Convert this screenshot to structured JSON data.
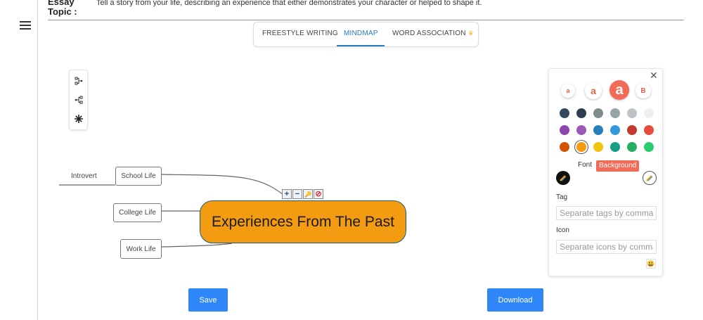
{
  "essay": {
    "label": "Essay\nTopic :",
    "text": "Tell a story from your life, describing an experience that either demonstrates your character or helped to shape it."
  },
  "tabs": [
    {
      "label": "FREESTYLE WRITING",
      "active": false
    },
    {
      "label": "MINDMAP",
      "active": true
    },
    {
      "label": "WORD ASSOCIATION",
      "active": false,
      "badge_icon": "crown-icon"
    }
  ],
  "mindmap": {
    "root": "Experiences From The Past",
    "nodes": [
      {
        "label": "Introvert"
      },
      {
        "label": "School Life"
      },
      {
        "label": "College Life"
      },
      {
        "label": "Work Life"
      }
    ],
    "node_controls": [
      "+",
      "−",
      "🔑",
      "⊘"
    ]
  },
  "style_panel": {
    "size_letters": [
      "a",
      "a",
      "a",
      "B"
    ],
    "colors": [
      "#34495e",
      "#2c3e50",
      "#7f8c8d",
      "#95a5a6",
      "#bdc3c7",
      "#ecf0f1",
      "#8e44ad",
      "#9b59b6",
      "#2980b9",
      "#3498db",
      "#c0392b",
      "#e74c3c",
      "#d35400",
      "#f39c12",
      "#f1c40f",
      "#16a085",
      "#27ae60",
      "#2ecc71"
    ],
    "selected_color": "#f39c12",
    "font_label": "Font",
    "background_label": "Background",
    "tag_label": "Tag",
    "tag_placeholder": "Separate tags by comma",
    "icon_label": "Icon",
    "icon_placeholder": "Separate icons by comma"
  },
  "buttons": {
    "save": "Save",
    "download": "Download"
  },
  "colors": {
    "accent": "#2c7cc4",
    "button": "#2f86f6",
    "root_fill": "#f39c12",
    "style_active": "#f26b56"
  }
}
